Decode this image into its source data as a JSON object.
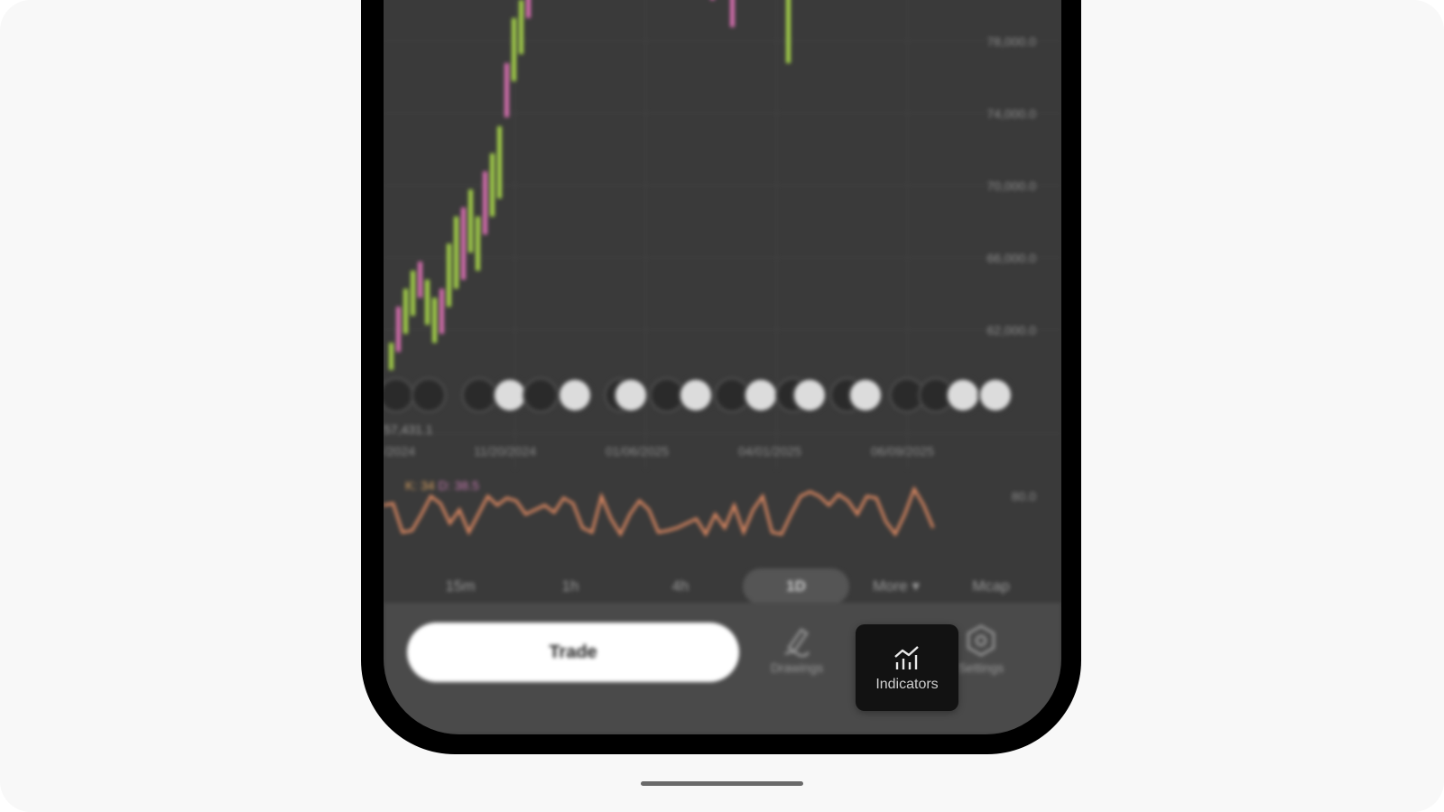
{
  "chart": {
    "y_axis": [
      "78,000.0",
      "74,000.0",
      "70,000.0",
      "66,000.0",
      "62,000.0"
    ],
    "x_axis": [
      "/2024",
      "11/20/2024",
      "01/06/2025",
      "04/01/2025",
      "06/09/2025"
    ],
    "price_tag": "57,431.1",
    "stoch_legend": {
      "k": "K: 34",
      "d": "D: 38.5"
    },
    "stoch_level": "80.0"
  },
  "timeframes": [
    "15m",
    "1h",
    "4h",
    "1D",
    "More ▾",
    "Mcap"
  ],
  "selected_timeframe": "1D",
  "toolbar": {
    "trade_label": "Trade",
    "drawings_label": "Drawings",
    "indicators_label": "Indicators",
    "settings_label": "Settings"
  },
  "colors": {
    "up": "#a6d44a",
    "down": "#d86fb0",
    "stoch": "#e08a62",
    "screen_bg": "#3a3a3a"
  }
}
